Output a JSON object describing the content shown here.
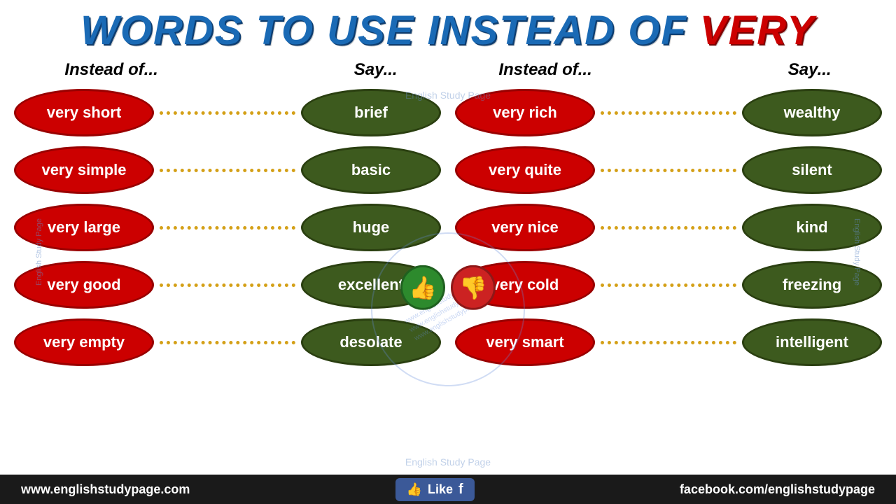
{
  "title": {
    "part1": "WORDS TO USE INSTEAD OF ",
    "part2": "VERY",
    "subtitle_left1": "Instead of...",
    "subtitle_left2": "Say...",
    "subtitle_right1": "Instead of...",
    "subtitle_right2": "Say..."
  },
  "left_pairs": [
    {
      "instead": "very short",
      "say": "brief"
    },
    {
      "instead": "very simple",
      "say": "basic"
    },
    {
      "instead": "very large",
      "say": "huge"
    },
    {
      "instead": "very good",
      "say": "excellent"
    },
    {
      "instead": "very empty",
      "say": "desolate"
    }
  ],
  "right_pairs": [
    {
      "instead": "very rich",
      "say": "wealthy"
    },
    {
      "instead": "very quite",
      "say": "silent"
    },
    {
      "instead": "very nice",
      "say": "kind"
    },
    {
      "instead": "very cold",
      "say": "freezing"
    },
    {
      "instead": "very smart",
      "say": "intelligent"
    }
  ],
  "watermarks": {
    "side": "English Study Page",
    "center_top": "English Study Page",
    "center_bottom": "English Study Page",
    "circle": "www.englishstudypage.com"
  },
  "footer": {
    "website": "www.englishstudypage.com",
    "like_label": "Like",
    "facebook": "facebook.com/englishstudypage"
  }
}
